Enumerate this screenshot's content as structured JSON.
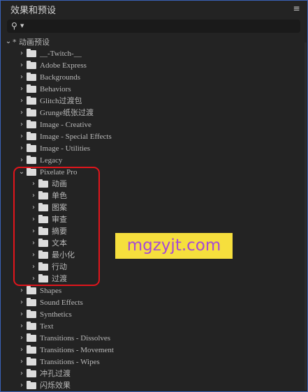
{
  "panel": {
    "title": "效果和预设",
    "menu_icon": "≡"
  },
  "search": {
    "icon": "search-icon",
    "value": "",
    "placeholder": ""
  },
  "tree": {
    "root": {
      "label": "* 动画预设",
      "expanded": true
    },
    "items": [
      {
        "label": "__-Twitch-__",
        "level": 1,
        "expanded": false
      },
      {
        "label": "Adobe Express",
        "level": 1,
        "expanded": false
      },
      {
        "label": "Backgrounds",
        "level": 1,
        "expanded": false
      },
      {
        "label": "Behaviors",
        "level": 1,
        "expanded": false
      },
      {
        "label": "Glitch过渡包",
        "level": 1,
        "expanded": false
      },
      {
        "label": "Grunge纸张过渡",
        "level": 1,
        "expanded": false
      },
      {
        "label": "Image - Creative",
        "level": 1,
        "expanded": false
      },
      {
        "label": "Image - Special Effects",
        "level": 1,
        "expanded": false
      },
      {
        "label": "Image - Utilities",
        "level": 1,
        "expanded": false
      },
      {
        "label": "Legacy",
        "level": 1,
        "expanded": false
      },
      {
        "label": "Pixelate Pro",
        "level": 1,
        "expanded": true
      },
      {
        "label": "动画",
        "level": 2,
        "expanded": false
      },
      {
        "label": "单色",
        "level": 2,
        "expanded": false
      },
      {
        "label": "图案",
        "level": 2,
        "expanded": false
      },
      {
        "label": "审查",
        "level": 2,
        "expanded": false
      },
      {
        "label": "摘要",
        "level": 2,
        "expanded": false
      },
      {
        "label": "文本",
        "level": 2,
        "expanded": false
      },
      {
        "label": "最小化",
        "level": 2,
        "expanded": false
      },
      {
        "label": "行动",
        "level": 2,
        "expanded": false
      },
      {
        "label": "过渡",
        "level": 2,
        "expanded": false
      },
      {
        "label": "Shapes",
        "level": 1,
        "expanded": false
      },
      {
        "label": "Sound Effects",
        "level": 1,
        "expanded": false
      },
      {
        "label": "Synthetics",
        "level": 1,
        "expanded": false
      },
      {
        "label": "Text",
        "level": 1,
        "expanded": false
      },
      {
        "label": "Transitions - Dissolves",
        "level": 1,
        "expanded": false
      },
      {
        "label": "Transitions - Movement",
        "level": 1,
        "expanded": false
      },
      {
        "label": "Transitions - Wipes",
        "level": 1,
        "expanded": false
      },
      {
        "label": "冲孔过渡",
        "level": 1,
        "expanded": false
      },
      {
        "label": "闪烁效果",
        "level": 1,
        "expanded": false
      }
    ]
  },
  "watermark": {
    "text": "mgzyjt.com"
  },
  "colors": {
    "panel_bg": "#232323",
    "highlight_border": "#e1151c",
    "watermark_bg": "#f6df3d",
    "watermark_text": "#a64bd4",
    "panel_border": "#3a62b8"
  }
}
